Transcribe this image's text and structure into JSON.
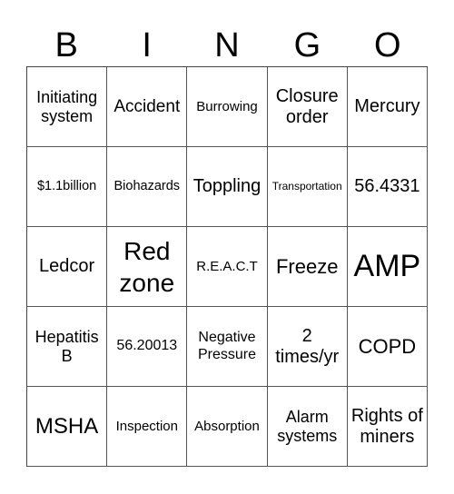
{
  "header": {
    "letters": [
      "B",
      "I",
      "N",
      "G",
      "O"
    ]
  },
  "card": {
    "rows": [
      [
        "Initiating system",
        "Accident",
        "Burrowing",
        "Closure order",
        "Mercury"
      ],
      [
        "$1.1billion",
        "Biohazards",
        "Toppling",
        "Transportation",
        "56.4331"
      ],
      [
        "Ledcor",
        "Red zone",
        "R.E.A.C.T",
        "Freeze",
        "AMP"
      ],
      [
        "Hepatitis B",
        "56.20013",
        "Negative Pressure",
        "2 times/yr",
        "COPD"
      ],
      [
        "MSHA",
        "Inspection",
        "Absorption",
        "Alarm systems",
        "Rights of miners"
      ]
    ]
  }
}
